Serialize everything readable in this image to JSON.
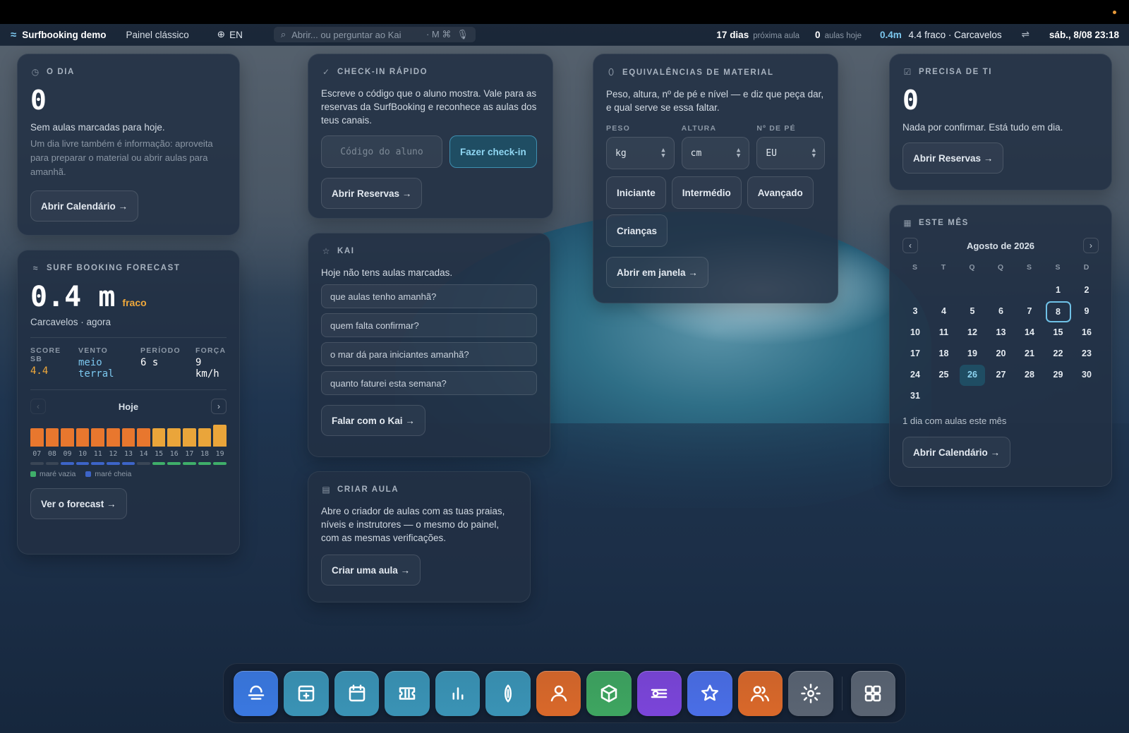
{
  "menubar": {
    "brand": "Surfbooking demo",
    "classic": "Painel clássico",
    "lang": "EN",
    "search_placeholder": "Abrir... ou perguntar ao Kai",
    "search_hint": "· M ⌘",
    "next_lesson_value": "17 dias",
    "next_lesson_label": "próxima aula",
    "today_value": "0",
    "today_label": "aulas hoje",
    "surf_height": "0.4m",
    "surf_desc": "4.4 fraco · Carcavelos",
    "clock": "sáb., 8/08 23:18"
  },
  "dia": {
    "title": "O DIA",
    "count": "0",
    "line1": "Sem aulas marcadas para hoje.",
    "line2": "Um dia livre também é informação: aproveita para preparar o material ou abrir aulas para amanhã.",
    "button": "Abrir Calendário →"
  },
  "forecast": {
    "title": "SURF BOOKING FORECAST",
    "height": "0.4 m",
    "quality": "fraco",
    "location": "Carcavelos · agora",
    "score_label": "SCORE SB",
    "score_value": "4.4",
    "wind_label": "VENTO",
    "wind_value": "meio terral",
    "period_label": "PERÍODO",
    "period_value": "6 s",
    "force_label": "FORÇA",
    "force_value": "9 km/h",
    "day": "Hoje",
    "prev": "‹",
    "next": "›",
    "legend_low": "maré vazia",
    "legend_high": "maré cheia",
    "button": "Ver o forecast →",
    "colors": {
      "orange": "#e8772e",
      "amber": "#eaa53a",
      "low_tide": "#3fae6a",
      "high_tide": "#3d64c8",
      "none": "#3a4656"
    }
  },
  "chart_data": {
    "type": "bar",
    "categories": [
      "07",
      "08",
      "09",
      "10",
      "11",
      "12",
      "13",
      "14",
      "15",
      "16",
      "17",
      "18",
      "19"
    ],
    "values": [
      0.75,
      0.75,
      0.75,
      0.75,
      0.75,
      0.75,
      0.75,
      0.75,
      0.75,
      0.75,
      0.75,
      0.75,
      0.9
    ],
    "bar_colors": [
      "orange",
      "orange",
      "orange",
      "orange",
      "orange",
      "orange",
      "orange",
      "orange",
      "amber",
      "amber",
      "amber",
      "amber",
      "amber"
    ],
    "tide": [
      "none",
      "none",
      "high",
      "high",
      "high",
      "high",
      "high",
      "none",
      "low",
      "low",
      "low",
      "low",
      "low"
    ],
    "ylim": [
      0,
      1
    ]
  },
  "checkin": {
    "title": "CHECK-IN RÁPIDO",
    "desc": "Escreve o código que o aluno mostra. Vale para as reservas da SurfBooking e reconhece as aulas dos teus canais.",
    "placeholder": "Código do aluno",
    "submit": "Fazer check-in",
    "button": "Abrir Reservas →"
  },
  "kai": {
    "title": "KAI",
    "intro": "Hoje não tens aulas marcadas.",
    "questions": [
      "que aulas tenho amanhã?",
      "quem falta confirmar?",
      "o mar dá para iniciantes amanhã?",
      "quanto faturei esta semana?"
    ],
    "button": "Falar com o Kai →"
  },
  "aula": {
    "title": "CRIAR AULA",
    "desc": "Abre o criador de aulas com as tuas praias, níveis e instrutores — o mesmo do painel, com as mesmas verificações.",
    "button": "Criar uma aula →"
  },
  "material": {
    "title": "EQUIVALÊNCIAS DE MATERIAL",
    "desc": "Peso, altura, nº de pé e nível — e diz que peça dar, e qual serve se essa faltar.",
    "weight_label": "PESO",
    "height_label": "ALTURA",
    "foot_label": "Nº DE PÉ",
    "weight_unit": "kg",
    "height_unit": "cm",
    "foot_unit": "EU",
    "levels": [
      "Iniciante",
      "Intermédio",
      "Avançado",
      "Crianças"
    ],
    "button": "Abrir em janela →"
  },
  "precisa": {
    "title": "PRECISA DE TI",
    "count": "0",
    "desc": "Nada por confirmar. Está tudo em dia.",
    "button": "Abrir Reservas →"
  },
  "mes": {
    "title": "ESTE MÊS",
    "month": "Agosto de 2026",
    "prev": "‹",
    "next": "›",
    "dow": [
      "S",
      "T",
      "Q",
      "Q",
      "S",
      "S",
      "D"
    ],
    "leading_blanks": 5,
    "days_in_month": 31,
    "today": 8,
    "lesson_days": [
      26
    ],
    "summary": "1 dia com aulas este mês",
    "button": "Abrir Calendário →"
  },
  "dock": {
    "apps": [
      {
        "name": "dock-app-surf",
        "color": "#3a78e0",
        "icon": "sunset"
      },
      {
        "name": "dock-app-bookings",
        "color": "#3a93b5",
        "icon": "booking"
      },
      {
        "name": "dock-app-calendar",
        "color": "#3a93b5",
        "icon": "calendar"
      },
      {
        "name": "dock-app-tickets",
        "color": "#3a93b5",
        "icon": "ticket"
      },
      {
        "name": "dock-app-stats",
        "color": "#3a93b5",
        "icon": "bars"
      },
      {
        "name": "dock-app-material",
        "color": "#3a93b5",
        "icon": "board"
      },
      {
        "name": "dock-app-instructors",
        "color": "#d9682a",
        "icon": "user"
      },
      {
        "name": "dock-app-inventory",
        "color": "#3ea560",
        "icon": "box"
      },
      {
        "name": "dock-app-filters",
        "color": "#7b45d9",
        "icon": "sliders"
      },
      {
        "name": "dock-app-kai",
        "color": "#4a6ee6",
        "icon": "star"
      },
      {
        "name": "dock-app-clients",
        "color": "#d9682a",
        "icon": "users"
      },
      {
        "name": "dock-app-settings",
        "color": "#5a6472",
        "icon": "gear"
      }
    ],
    "launcher": {
      "name": "dock-app-launcher",
      "color": "#5a6472",
      "icon": "grid"
    }
  }
}
